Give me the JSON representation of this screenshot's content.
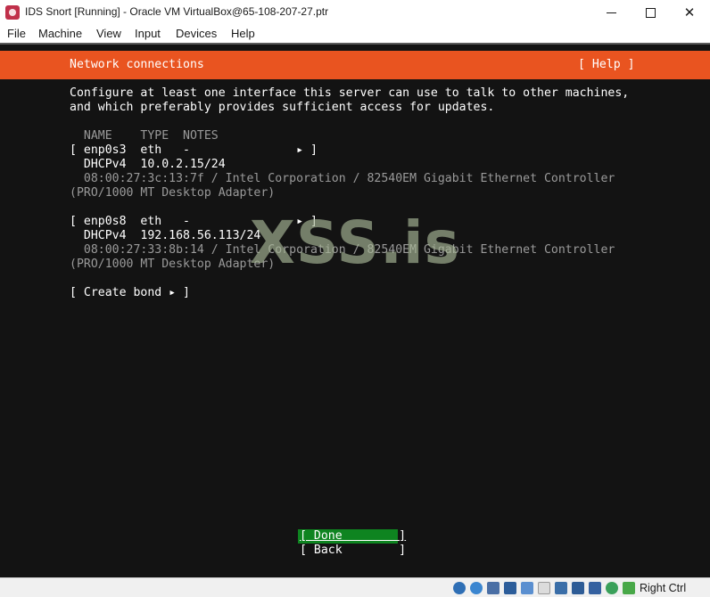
{
  "window": {
    "title": "IDS Snort [Running] - Oracle VM VirtualBox@65-108-207-27.ptr",
    "close_glyph": "✕"
  },
  "menu": [
    "File",
    "Machine",
    "View",
    "Input",
    "Devices",
    "Help"
  ],
  "installer": {
    "header_title": "Network connections",
    "help_label": "[ Help ]",
    "description_line1": "Configure at least one interface this server can use to talk to other machines,",
    "description_line2": "and which preferably provides sufficient access for updates.",
    "column_header": "  NAME    TYPE  NOTES",
    "interfaces": [
      {
        "row": "[ enp0s3  eth   -               ▸ ]",
        "dhcp": "  DHCPv4  10.0.2.15/24",
        "hw_line1": "  08:00:27:3c:13:7f / Intel Corporation / 82540EM Gigabit Ethernet Controller",
        "hw_line2": "(PRO/1000 MT Desktop Adapter)"
      },
      {
        "row": "[ enp0s8  eth   -               ▸ ]",
        "dhcp": "  DHCPv4  192.168.56.113/24",
        "hw_line1": "  08:00:27:33:8b:14 / Intel Corporation / 82540EM Gigabit Ethernet Controller",
        "hw_line2": "(PRO/1000 MT Desktop Adapter)"
      }
    ],
    "create_bond_label": "[ Create bond ▸ ]",
    "done_label": "[ Done        ]",
    "back_label": "[ Back        ]"
  },
  "watermark": "XSS.is",
  "statusbar": {
    "host_key": "Right Ctrl",
    "icons": [
      "optical-drive-icon",
      "audio-icon",
      "network-icon",
      "usb-icon",
      "shared-folders-icon",
      "display-icon",
      "video-capture-icon",
      "recording-icon",
      "cpu-icon",
      "mouse-integration-icon",
      "keyboard-capture-icon",
      "arrow-down-icon"
    ]
  },
  "colors": {
    "accent": "#e95420",
    "done_button": "#0e8420",
    "terminal_bg": "#131313"
  }
}
